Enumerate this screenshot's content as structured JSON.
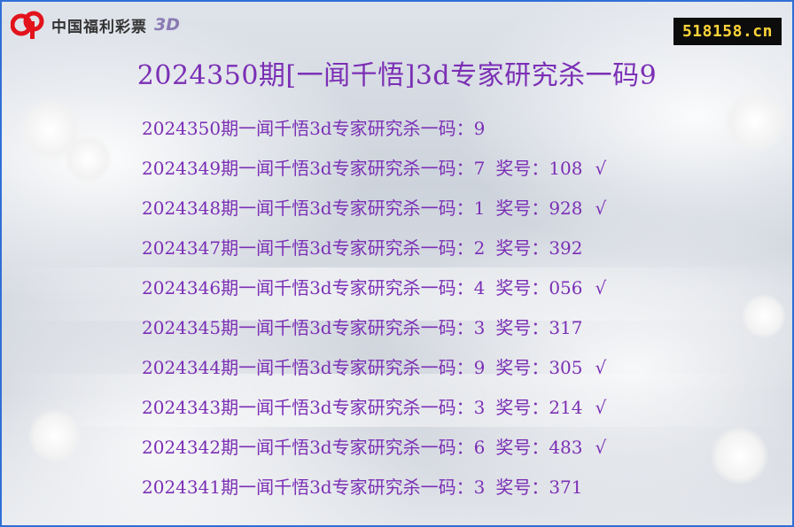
{
  "logo": {
    "text": "中国福利彩票",
    "suffix": "3D",
    "colors": {
      "red": "#e3131b",
      "text": "#333333",
      "suffix": "#8a7ab3"
    }
  },
  "site_badge": {
    "text": "518158.cn",
    "bg": "#0c0c0c",
    "color": "#ffd43a"
  },
  "title": "2024350期[一闻千悟]3d专家研究杀一码9",
  "accent_color": "#7b2fb5",
  "rows": [
    {
      "label": "2024350期一闻千悟3d专家研究杀一码：9",
      "prize": "",
      "check": ""
    },
    {
      "label": "2024349期一闻千悟3d专家研究杀一码：7",
      "prize": "奖号：108",
      "check": "√"
    },
    {
      "label": "2024348期一闻千悟3d专家研究杀一码：1",
      "prize": "奖号：928",
      "check": "√"
    },
    {
      "label": "2024347期一闻千悟3d专家研究杀一码：2",
      "prize": "奖号：392",
      "check": ""
    },
    {
      "label": "2024346期一闻千悟3d专家研究杀一码：4",
      "prize": "奖号：056",
      "check": "√"
    },
    {
      "label": "2024345期一闻千悟3d专家研究杀一码：3",
      "prize": "奖号：317",
      "check": ""
    },
    {
      "label": "2024344期一闻千悟3d专家研究杀一码：9",
      "prize": "奖号：305",
      "check": "√"
    },
    {
      "label": "2024343期一闻千悟3d专家研究杀一码：3",
      "prize": "奖号：214",
      "check": "√"
    },
    {
      "label": "2024342期一闻千悟3d专家研究杀一码：6",
      "prize": "奖号：483",
      "check": "√"
    },
    {
      "label": "2024341期一闻千悟3d专家研究杀一码：3",
      "prize": "奖号：371",
      "check": ""
    }
  ]
}
